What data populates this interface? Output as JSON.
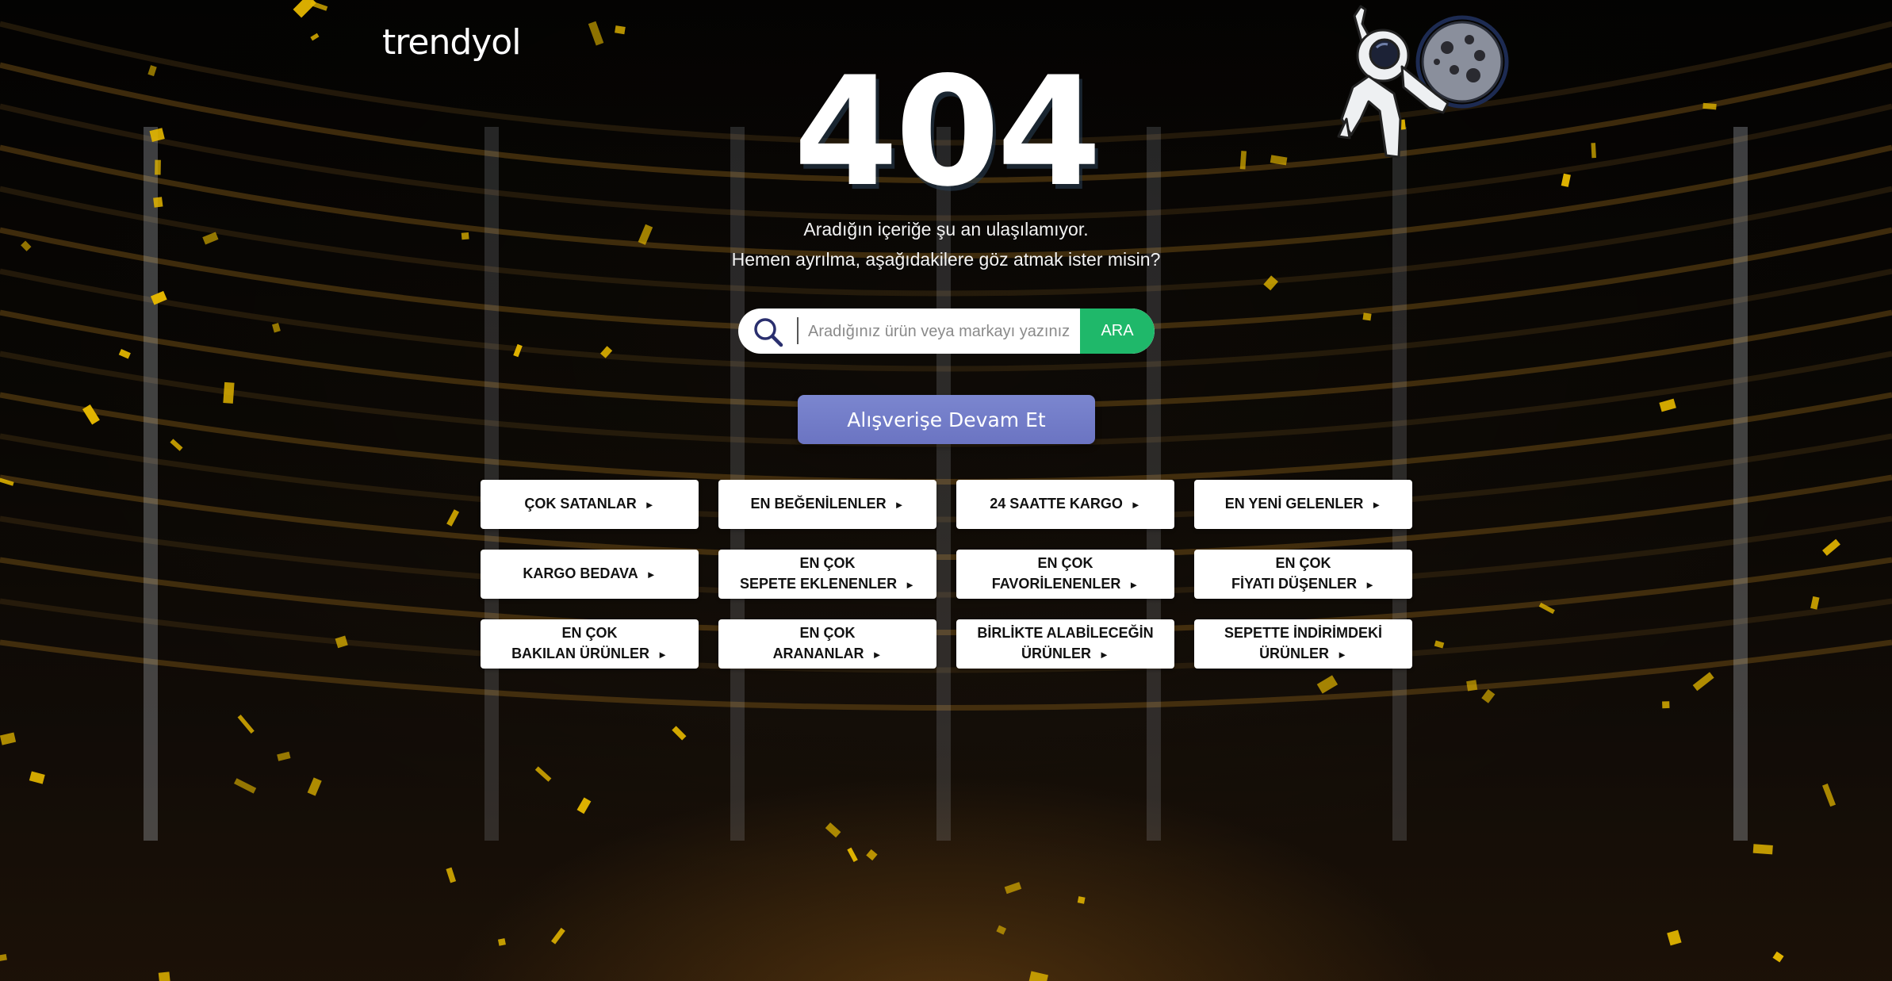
{
  "brand": {
    "logo_text": "trendyol"
  },
  "error": {
    "code": "404",
    "line1": "Aradığın içeriğe şu an ulaşılamıyor.",
    "line2": "Hemen ayrılma, aşağıdakilere göz atmak ister misin?"
  },
  "search": {
    "placeholder": "Aradığınız ürün veya markayı yazınız",
    "button_label": "ARA",
    "icon": "search-icon"
  },
  "cta": {
    "label": "Alışverişe Devam Et"
  },
  "shortcuts": [
    {
      "line1": "ÇOK SATANLAR",
      "line2": ""
    },
    {
      "line1": "EN BEĞENİLENLER",
      "line2": ""
    },
    {
      "line1": "24 SAATTE KARGO",
      "line2": ""
    },
    {
      "line1": "EN YENİ GELENLER",
      "line2": ""
    },
    {
      "line1": "KARGO BEDAVA",
      "line2": ""
    },
    {
      "line1": "EN ÇOK",
      "line2": "SEPETE EKLENENLER"
    },
    {
      "line1": "EN ÇOK",
      "line2": "FAVORİLENENLER"
    },
    {
      "line1": "EN ÇOK",
      "line2": "FİYATI DÜŞENLER"
    },
    {
      "line1": "EN ÇOK",
      "line2": "BAKILAN ÜRÜNLER"
    },
    {
      "line1": "EN ÇOK",
      "line2": "ARANANLAR"
    },
    {
      "line1": "BİRLİKTE ALABİLECEĞİN",
      "line2": "ÜRÜNLER"
    },
    {
      "line1": "SEPETTE İNDİRİMDEKİ",
      "line2": "ÜRÜNLER"
    }
  ],
  "arrow_glyph": "►",
  "colors": {
    "search_button": "#1fb86a",
    "cta": "#6f78c6",
    "confetti": "#e6b800"
  },
  "illustration": {
    "name": "astronaut-with-moon"
  }
}
